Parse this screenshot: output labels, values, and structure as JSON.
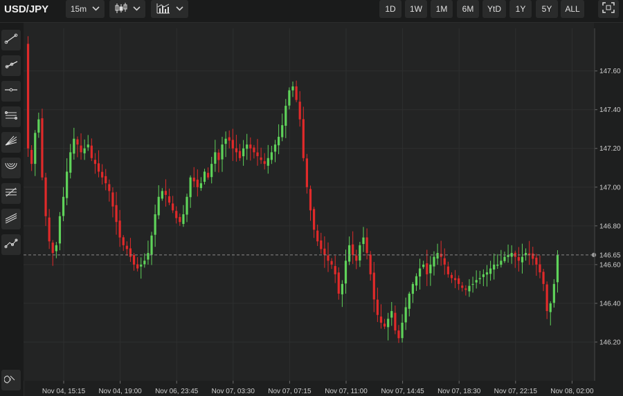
{
  "toolbar": {
    "symbol": "USD/JPY",
    "interval": "15m",
    "chart_type_icon": "candlestick-icon",
    "indicators_icon": "indicators-icon",
    "ranges": [
      "1D",
      "1W",
      "1M",
      "6M",
      "YtD",
      "1Y",
      "5Y",
      "ALL"
    ],
    "fullscreen_icon": "fullscreen-icon"
  },
  "drawing_tools": [
    "trend-line-icon",
    "ray-icon",
    "horizontal-line-icon",
    "parallel-channel-icon",
    "fib-fan-icon",
    "fib-arcs-icon",
    "fib-retracement-icon",
    "pitchfork-icon",
    "path-icon",
    "magnet-icon"
  ],
  "colors": {
    "up": "#5fd35a",
    "down": "#e02a2a",
    "background": "#232424",
    "grid": "#2e2f2f",
    "current_price_line": "#8a8a8a"
  },
  "chart_data": {
    "type": "candlestick",
    "y_ticks": [
      "147.60",
      "147.40",
      "147.20",
      "147.00",
      "146.80",
      "146.60",
      "146.40",
      "146.20"
    ],
    "ylim": [
      146.0,
      147.82
    ],
    "x_tick_labels": [
      "Nov 04, 15:15",
      "Nov 04, 19:00",
      "Nov 06, 23:45",
      "Nov 07, 03:30",
      "Nov 07, 07:15",
      "Nov 07, 11:00",
      "Nov 07, 14:45",
      "Nov 07, 18:30",
      "Nov 07, 22:15",
      "Nov 08, 02:00"
    ],
    "current_price": 146.65,
    "current_price_label": "146.65",
    "grid": true,
    "closes": [
      147.2,
      147.12,
      147.28,
      147.35,
      147.05,
      146.85,
      146.72,
      146.66,
      146.7,
      146.85,
      146.95,
      147.08,
      147.18,
      147.25,
      147.22,
      147.18,
      147.2,
      147.22,
      147.15,
      147.12,
      147.08,
      147.05,
      147.02,
      146.98,
      146.9,
      146.82,
      146.74,
      146.7,
      146.68,
      146.64,
      146.6,
      146.58,
      146.6,
      146.62,
      146.66,
      146.75,
      146.86,
      146.95,
      146.98,
      146.96,
      146.92,
      146.88,
      146.84,
      146.82,
      146.86,
      146.95,
      147.05,
      147.03,
      147.0,
      147.02,
      147.08,
      147.05,
      147.12,
      147.18,
      147.14,
      147.22,
      147.25,
      147.24,
      147.2,
      147.18,
      147.15,
      147.2,
      147.22,
      147.2,
      147.18,
      147.16,
      147.14,
      147.12,
      147.15,
      147.18,
      147.22,
      147.26,
      147.32,
      147.42,
      147.5,
      147.52,
      147.45,
      147.35,
      147.15,
      147.0,
      146.88,
      146.78,
      146.72,
      146.68,
      146.65,
      146.62,
      146.6,
      146.55,
      146.45,
      146.5,
      146.62,
      146.7,
      146.65,
      146.62,
      146.7,
      146.74,
      146.66,
      146.55,
      146.42,
      146.34,
      146.3,
      146.28,
      146.32,
      146.36,
      146.26,
      146.22,
      146.3,
      146.38,
      146.45,
      146.5,
      146.54,
      146.58,
      146.6,
      146.55,
      146.6,
      146.64,
      146.66,
      146.64,
      146.6,
      146.55,
      146.53,
      146.52,
      146.5,
      146.48,
      146.47,
      146.49,
      146.5,
      146.52,
      146.53,
      146.55,
      146.56,
      146.58,
      146.6,
      146.6,
      146.62,
      146.64,
      146.65,
      146.66,
      146.64,
      146.62,
      146.64,
      146.66,
      146.65,
      146.63,
      146.6,
      146.56,
      146.5,
      146.36,
      146.4,
      146.5,
      146.65
    ]
  }
}
